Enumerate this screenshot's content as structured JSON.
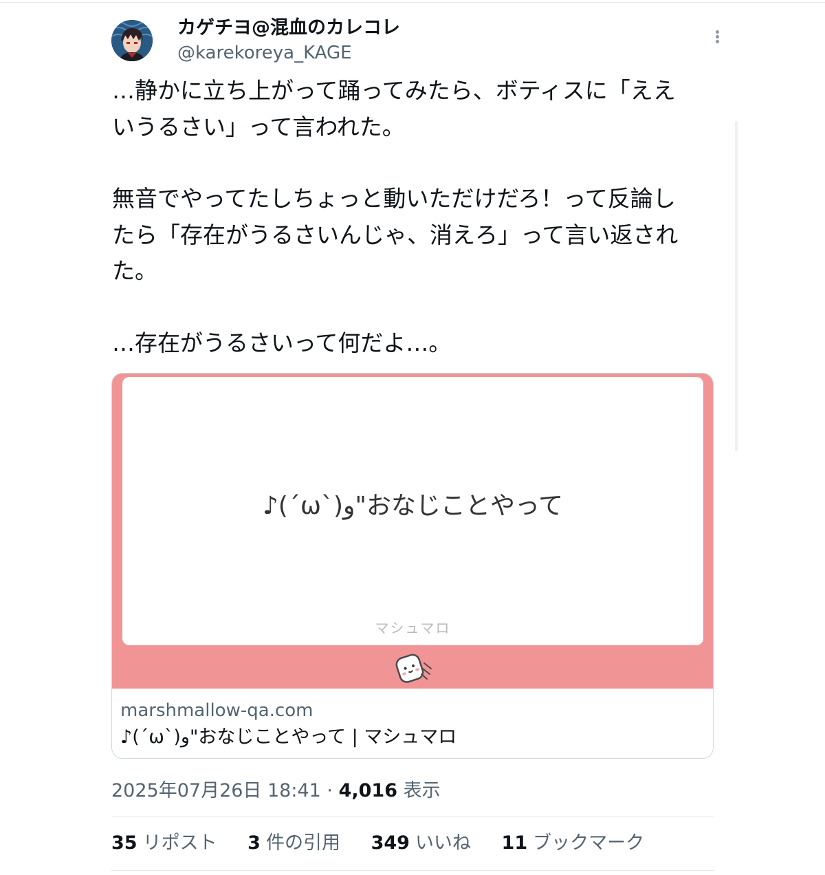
{
  "author": {
    "display_name": "カゲチヨ@混血のカレコレ",
    "handle": "@karekoreya_KAGE"
  },
  "tweet": {
    "paragraphs": [
      "…静かに立ち上がって踊ってみたら、ボティスに「ええ\nいうるさい」って言われた。",
      "無音でやってたしちょっと動いただけだろ！って反論し\nたら「存在がうるさいんじゃ、消えろ」って言い返され\nた。",
      "…存在がうるさいって何だよ…。"
    ]
  },
  "card": {
    "question_text": "♪(´ω`)و\"おなじことやって",
    "watermark": "マシュマロ",
    "domain": "marshmallow-qa.com",
    "title": "♪(´ω`)و\"おなじことやって | マシュマロ",
    "media_color": "#f19496"
  },
  "meta": {
    "timestamp": "2025年07月26日 18:41",
    "separator": " · ",
    "views_count": "4,016",
    "views_label": " 表示"
  },
  "stats": [
    {
      "count": "35",
      "label": "リポスト"
    },
    {
      "count": "3",
      "label": "件の引用"
    },
    {
      "count": "349",
      "label": "いいね"
    },
    {
      "count": "11",
      "label": "ブックマーク"
    }
  ],
  "icons": {
    "avatar": "user-avatar",
    "more": "more-options-icon",
    "mascot": "marshmallow-mascot-icon"
  }
}
